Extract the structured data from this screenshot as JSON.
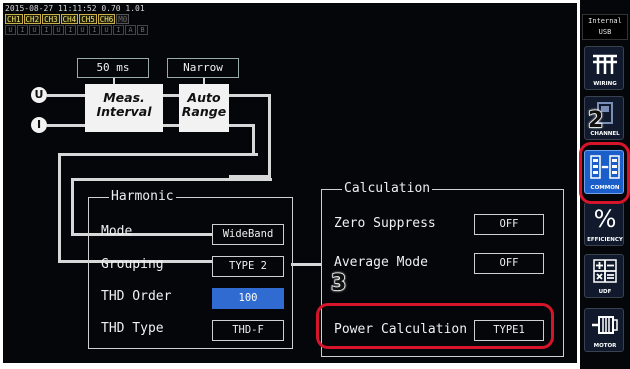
{
  "status": {
    "datetime": "2015-08-27 11:11:52 0.70 1.01",
    "channels": [
      "CH1",
      "CH2",
      "CH3",
      "CH4",
      "CH5",
      "CH6",
      "M0"
    ],
    "channels_on": [
      true,
      true,
      true,
      true,
      true,
      true,
      false
    ],
    "status_labels": [
      "U",
      "I",
      "U",
      "I",
      "U",
      "I",
      "U",
      "I",
      "U",
      "I",
      "A",
      "B"
    ]
  },
  "diagram": {
    "interval_value": "50 ms",
    "range_value": "Narrow",
    "meas_interval_line1": "Meas.",
    "meas_interval_line2": "Interval",
    "auto_range_line1": "Auto",
    "auto_range_line2": "Range",
    "u_label": "U",
    "i_label": "I"
  },
  "harmonic": {
    "title": "Harmonic",
    "rows": [
      {
        "label": "Mode",
        "value": "WideBand",
        "selected": false
      },
      {
        "label": "Grouping",
        "value": "TYPE 2",
        "selected": false
      },
      {
        "label": "THD Order",
        "value": "100",
        "selected": true
      },
      {
        "label": "THD Type",
        "value": "THD-F",
        "selected": false
      }
    ]
  },
  "calculation": {
    "title": "Calculation",
    "rows": [
      {
        "label": "Zero Suppress",
        "value": "OFF"
      },
      {
        "label": "Average Mode",
        "value": "OFF"
      },
      {
        "label": "Power Calculation",
        "value": "TYPE1"
      }
    ]
  },
  "annotations": {
    "step2": "2",
    "step3": "3",
    "highlight_color": "#d6152b"
  },
  "sidebar": {
    "storage_line1": "Internal",
    "storage_line2": "USB",
    "items": [
      {
        "label": "WIRING",
        "icon": "wiring-icon",
        "active": false
      },
      {
        "label": "CHANNEL",
        "icon": "channel-icon",
        "active": false
      },
      {
        "label": "COMMON",
        "icon": "common-icon",
        "active": true
      },
      {
        "label": "EFFICIENCY",
        "icon": "efficiency-icon",
        "active": false
      },
      {
        "label": "UDF",
        "icon": "udf-icon",
        "active": false
      },
      {
        "label": "MOTOR",
        "icon": "motor-icon",
        "active": false
      }
    ]
  },
  "colors": {
    "selected_value": "#2f6bd0",
    "active_tab": "#1c5ec9",
    "channel_on": "#f4e26a"
  }
}
